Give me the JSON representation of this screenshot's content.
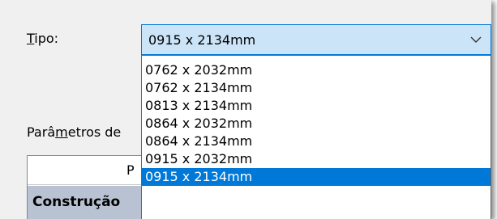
{
  "form": {
    "type_label_mnemonic": "T",
    "type_label_rest": "ipo:",
    "combo_value": "0915 x 2134mm",
    "params_label_a": "Parâ",
    "params_label_mnemonic": "m",
    "params_label_b": "etros de",
    "grid_header": "P",
    "group_row": "Construção"
  },
  "dropdown": {
    "selected_index": 6,
    "options": [
      "0762 x 2032mm",
      "0762 x 2134mm",
      "0813 x 2134mm",
      "0864 x 2032mm",
      "0864 x 2134mm",
      "0915 x 2032mm",
      "0915 x 2134mm"
    ]
  },
  "colors": {
    "selection": "#0078d7",
    "combo_focus": "#cce4f7",
    "group_row": "#b8c2d3"
  },
  "icons": {
    "combo_arrow": "chevron-down-icon"
  }
}
